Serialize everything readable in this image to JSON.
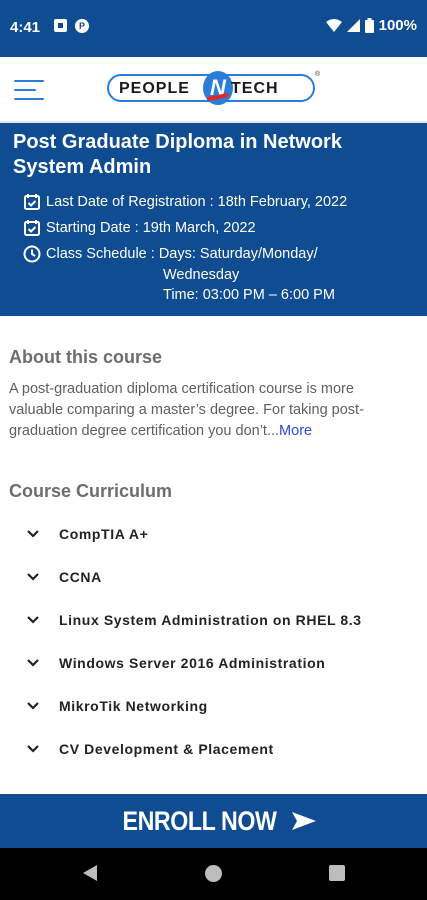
{
  "status_bar": {
    "time": "4:41",
    "battery": "100%"
  },
  "app_bar": {
    "logo_left": "PEOPLE",
    "logo_mark": "N",
    "logo_right": "TECH",
    "logo_registered": "®"
  },
  "course": {
    "title": "Post Graduate Diploma in Network System Admin",
    "registration": "Last Date of Registration : 18th February, 2022",
    "starting": "Starting Date : 19th March, 2022",
    "schedule_label": "Class Schedule : Days:  Saturday/Monday/",
    "schedule_days_cont": "Wednesday",
    "schedule_time": "Time: 03:00 PM – 6:00 PM"
  },
  "about": {
    "heading": "About this course",
    "text": "A post-graduation diploma certification course is more valuable comparing a master’s degree. For taking post-graduation degree certification you don’t...",
    "more": "More"
  },
  "curriculum": {
    "heading": "Course Curriculum",
    "items": [
      {
        "label": "CompTIA A+"
      },
      {
        "label": "CCNA"
      },
      {
        "label": "Linux System Administration on RHEL 8.3"
      },
      {
        "label": "Windows Server 2016 Administration"
      },
      {
        "label": "MikroTik Networking"
      },
      {
        "label": "CV Development & Placement"
      }
    ]
  },
  "enroll": {
    "label": "ENROLL NOW"
  },
  "colors": {
    "primary": "#0f4c92",
    "accent": "#2a7ed8",
    "link": "#2a4bd8",
    "logo_swoosh": "#e4262c"
  }
}
